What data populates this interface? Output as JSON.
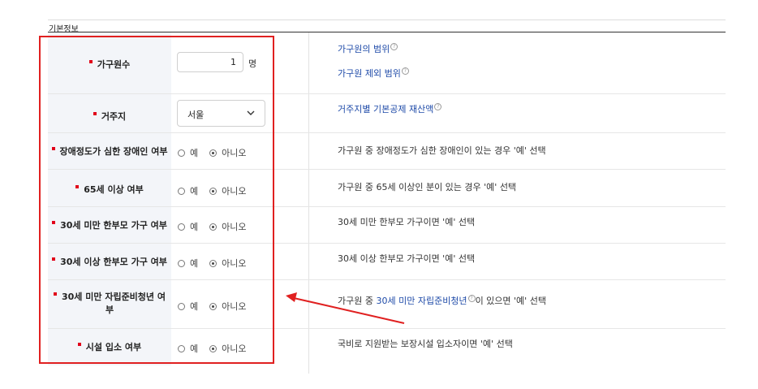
{
  "section": {
    "title": "기본정보"
  },
  "household": {
    "label": "가구원수",
    "count": "1",
    "unit": "명",
    "link1": "가구원의 범위",
    "link2": "가구원 제외 범위"
  },
  "residence": {
    "label": "거주지",
    "selected": "서울",
    "link": "거주지별 기본공제 재산액"
  },
  "radio_options": {
    "yes": "예",
    "no": "아니오"
  },
  "rows": [
    {
      "label": "장애정도가 심한 장애인 여부",
      "desc": "가구원 중 장애정도가 심한 장애인이 있는 경우 '예' 선택"
    },
    {
      "label": "65세 이상 여부",
      "desc": "가구원 중 65세 이상인 분이 있는 경우 '예' 선택"
    },
    {
      "label": "30세 미만 한부모 가구 여부",
      "desc": "30세 미만 한부모 가구이면 '예' 선택"
    },
    {
      "label": "30세 이상 한부모 가구 여부",
      "desc": "30세 이상 한부모 가구이면 '예' 선택"
    },
    {
      "label_line1": "30세 미만 자립준비청년 여",
      "label_line2": "부",
      "desc_pre": "가구원 중 ",
      "desc_link": "30세 미만 자립준비청년",
      "desc_post": "이 있으면 '예' 선택"
    },
    {
      "label": "시설 입소 여부",
      "desc": "국비로 지원받는 보장시설 입소자이면 '예' 선택"
    }
  ],
  "help_glyph": "?",
  "colors": {
    "required": "#e1001a",
    "link": "#1e4aa8",
    "highlight": "#e02020",
    "label_bg": "#f3f5f9"
  }
}
